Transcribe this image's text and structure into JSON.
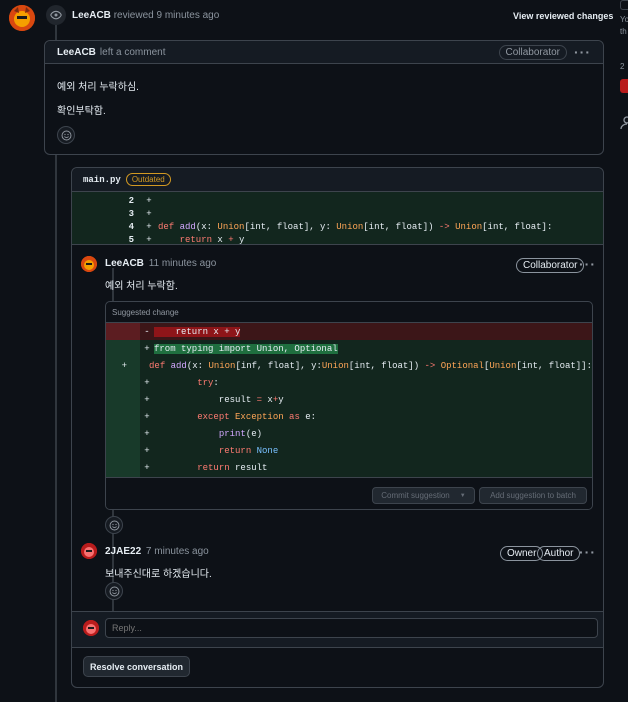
{
  "top_event": {
    "user": "LeeACB",
    "action": "reviewed 9 minutes ago",
    "view_changes": "View reviewed changes"
  },
  "review_comment": {
    "user": "LeeACB",
    "action": "left a comment",
    "badge": "Collaborator",
    "lines": [
      "예외 처리 누락하심.",
      "확인부탁함."
    ]
  },
  "file": {
    "name": "main.py",
    "status": "Outdated",
    "diff": [
      {
        "num": "2",
        "sign": "+",
        "code": ""
      },
      {
        "num": "3",
        "sign": "+",
        "code": ""
      },
      {
        "num": "4",
        "sign": "+",
        "code": "def add(x: Union[int, float], y: Union[int, float]) -> Union[int, float]:"
      },
      {
        "num": "5",
        "sign": "+",
        "code": "    return x + y"
      }
    ]
  },
  "thread_comment_1": {
    "user": "LeeACB",
    "time": "11 minutes ago",
    "badge": "Collaborator",
    "body": "예외 처리 누락함.",
    "suggested_label": "Suggested change",
    "removed_line": "    return x + y",
    "added_lines": [
      "from typing import Union, Optional",
      "    def add(x: Union[inf, float], y:Union[int, float]) -> Optional[Union[int, float]]:",
      "        try:",
      "            result = x+y",
      "        except Exception as e:",
      "            print(e)",
      "            return None",
      "        return result"
    ],
    "commit_button": "Commit suggestion",
    "batch_button": "Add suggestion to batch"
  },
  "thread_comment_2": {
    "user": "2JAE22",
    "time": "7 minutes ago",
    "badge_owner": "Owner",
    "badge_author": "Author",
    "body": "보내주신대로 하겠습니다."
  },
  "reply": {
    "placeholder": "Reply..."
  },
  "resolve_button": "Resolve conversation",
  "sidebar": {
    "text1": "Yo",
    "text2": "th",
    "number": "2"
  },
  "colors": {
    "background": "#0d1117",
    "added_bg": "#12261e",
    "removed_bg": "#3c1618",
    "accent_orange": "#d29922"
  }
}
